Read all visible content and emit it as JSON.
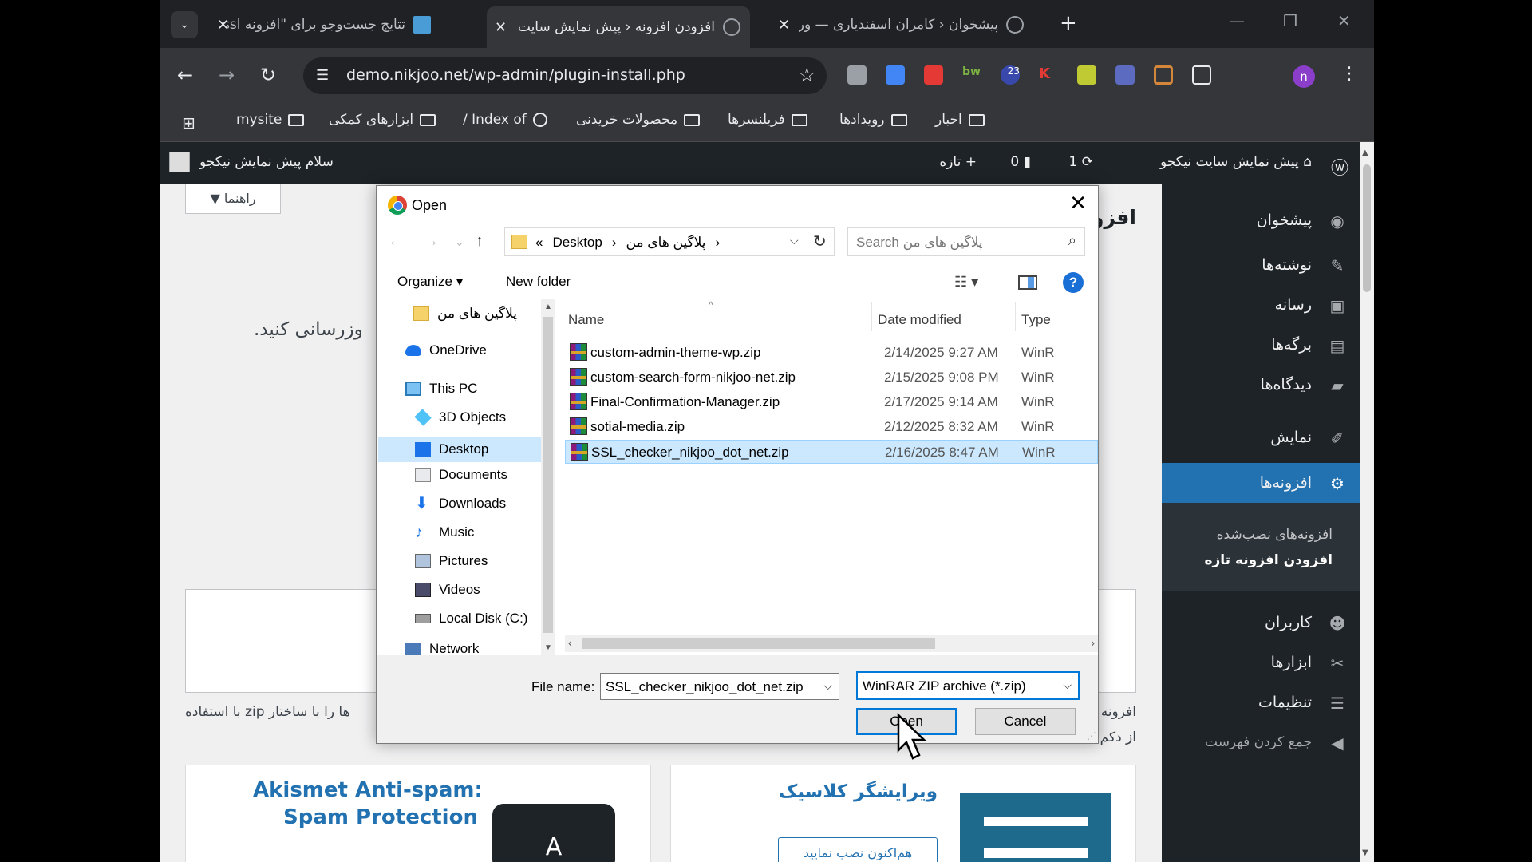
{
  "browser": {
    "tabs": [
      {
        "title": "تتایج جست‌وجو برای \"افزونه ssl\" -",
        "active": false
      },
      {
        "title": "افزودن افزونه ‹ پیش نمایش سایت",
        "active": true
      },
      {
        "title": "پیشخوان ‹ کامران اسفندیاری — ور",
        "active": false
      }
    ],
    "tab_close": "✕",
    "new_tab": "+",
    "url": "demo.nikjoo.net/wp-admin/plugin-install.php",
    "profile_initial": "n",
    "extension_badge": "23",
    "bookmarks": [
      "mysite",
      "ابزارهای کمکی",
      "Index of /",
      "محصولات خریدنی",
      "فریلنسرها",
      "رویدادها",
      "اخبار"
    ]
  },
  "adminbar": {
    "greeting": "سلام پیش نمایش نیکجو",
    "site_name": "پیش نمایش سایت نیکجو",
    "updates_count": "1",
    "comments_count": "0",
    "new_label": "تازه"
  },
  "sidebar": {
    "items": [
      {
        "label": "پیشخوان",
        "icon": "dashboard-icon"
      },
      {
        "label": "نوشته‌ها",
        "icon": "pin-icon"
      },
      {
        "label": "رسانه",
        "icon": "media-icon"
      },
      {
        "label": "برگه‌ها",
        "icon": "page-icon"
      },
      {
        "label": "دیدگاه‌ها",
        "icon": "comment-icon"
      },
      {
        "label": "نمایش",
        "icon": "brush-icon"
      },
      {
        "label": "افزونه‌ها",
        "icon": "plugin-icon"
      },
      {
        "label": "کاربران",
        "icon": "user-icon"
      },
      {
        "label": "ابزارها",
        "icon": "wrench-icon"
      },
      {
        "label": "تنظیمات",
        "icon": "settings-icon"
      },
      {
        "label": "جمع کردن فهرست",
        "icon": "collapse-icon"
      }
    ],
    "submenu": [
      "افزونه‌های نصب‌شده",
      "افزودن افزونه تازه"
    ]
  },
  "content": {
    "help_tab": "راهنما ▼",
    "page_heading_fragment": "افزو",
    "visible_text_1": "وزرسانی کنید.",
    "visible_text_2": "ها را با ساختار zip با استفاده",
    "visible_text_3": "افزونه",
    "visible_text_4": "از دکم",
    "card1_title_1": "Akismet Anti-spam:",
    "card1_title_2": "Spam Protection",
    "card2_title": "ویرایشگر کلاسیک",
    "card2_button": "هم‌اکنون نصب نمایید"
  },
  "dialog": {
    "title": "Open",
    "close": "✕",
    "path": [
      "«",
      "Desktop",
      "›",
      "پلاگین های من",
      "›"
    ],
    "search_placeholder": "Search پلاگین های من",
    "organize": "Organize ▾",
    "new_folder": "New folder",
    "help": "?",
    "nav_items": [
      {
        "label": "پلاگین های من",
        "icon": "folder-icon"
      },
      {
        "label": "OneDrive",
        "icon": "cloud-icon"
      },
      {
        "label": "This PC",
        "icon": "computer-icon"
      },
      {
        "label": "3D Objects",
        "icon": "cube-icon"
      },
      {
        "label": "Desktop",
        "icon": "desktop-icon",
        "selected": true
      },
      {
        "label": "Documents",
        "icon": "document-icon"
      },
      {
        "label": "Downloads",
        "icon": "download-icon"
      },
      {
        "label": "Music",
        "icon": "music-icon"
      },
      {
        "label": "Pictures",
        "icon": "picture-icon"
      },
      {
        "label": "Videos",
        "icon": "video-icon"
      },
      {
        "label": "Local Disk (C:)",
        "icon": "disk-icon"
      },
      {
        "label": "Network",
        "icon": "network-icon"
      }
    ],
    "columns": [
      "Name",
      "Date modified",
      "Type"
    ],
    "files": [
      {
        "name": "custom-admin-theme-wp.zip",
        "date": "2/14/2025 9:27 AM",
        "type": "WinR"
      },
      {
        "name": "custom-search-form-nikjoo-net.zip",
        "date": "2/15/2025 9:08 PM",
        "type": "WinR"
      },
      {
        "name": "Final-Confirmation-Manager.zip",
        "date": "2/17/2025 9:14 AM",
        "type": "WinR"
      },
      {
        "name": "sotial-media.zip",
        "date": "2/12/2025 8:32 AM",
        "type": "WinR"
      },
      {
        "name": "SSL_checker_nikjoo_dot_net.zip",
        "date": "2/16/2025 8:47 AM",
        "type": "WinR",
        "selected": true
      }
    ],
    "filename_label": "File name:",
    "filename_value": "SSL_checker_nikjoo_dot_net.zip",
    "filetype_value": "WinRAR ZIP archive (*.zip)",
    "open_button": "Open",
    "cancel_button": "Cancel"
  },
  "colors": {
    "wp_dark": "#1d2327",
    "wp_blue": "#2271b1",
    "selection": "#cce8ff",
    "focus": "#0078d7"
  }
}
